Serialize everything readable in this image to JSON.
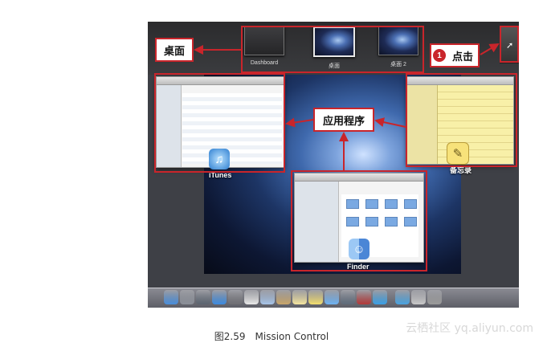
{
  "spaces": [
    {
      "label": "Dashboard"
    },
    {
      "label": "桌面"
    },
    {
      "label": "桌面 2"
    }
  ],
  "apps": {
    "itunes": {
      "label": "iTunes"
    },
    "notes": {
      "label": "备忘录"
    },
    "finder": {
      "label": "Finder"
    }
  },
  "annotations": {
    "desktop_label": "桌面",
    "click_step": "1",
    "click_label": "点击",
    "apps_label": "应用程序"
  },
  "caption": "图2.59　Mission Control",
  "watermark": "云栖社区 yq.aliyun.com",
  "colors": {
    "annotation_red": "#c9252b"
  },
  "dock_icons": [
    "finder-icon",
    "launchpad-icon",
    "mission-control-icon",
    "safari-icon",
    "system-prefs-icon",
    "calendar-icon",
    "mail-icon",
    "contacts-icon",
    "notes-icon",
    "stickies-icon",
    "messages-icon",
    "facetime-icon",
    "photo-booth-icon",
    "itunes-icon",
    "app-store-icon",
    "preview-icon",
    "trash-icon"
  ]
}
